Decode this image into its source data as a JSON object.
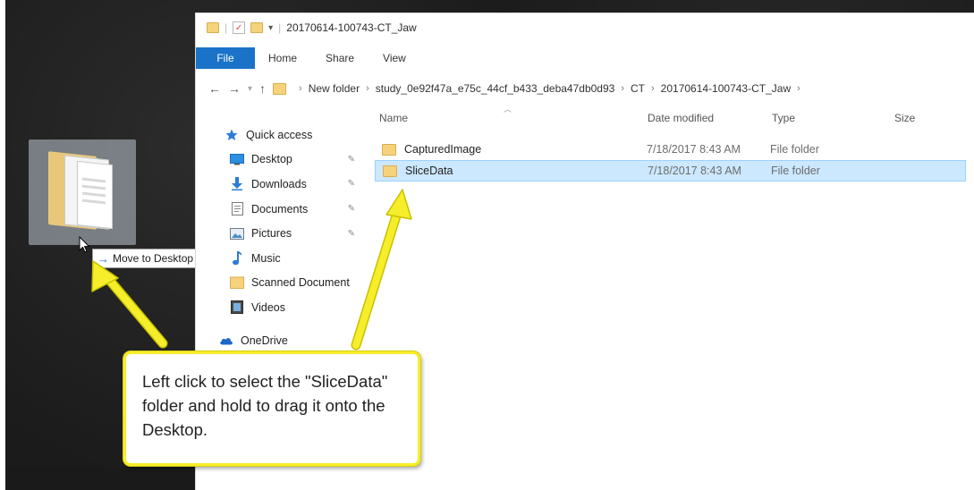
{
  "window": {
    "title": "20170614-100743-CT_Jaw"
  },
  "ribbon": {
    "tabs": [
      "File",
      "Home",
      "Share",
      "View"
    ]
  },
  "address": {
    "crumbs": [
      "New folder",
      "study_0e92f47a_e75c_44cf_b433_deba47db0d93",
      "CT",
      "20170614-100743-CT_Jaw"
    ]
  },
  "nav": {
    "items": [
      {
        "label": "Quick access",
        "icon": "star-icon",
        "pinned": false
      },
      {
        "label": "Desktop",
        "icon": "desktop-icon",
        "pinned": true
      },
      {
        "label": "Downloads",
        "icon": "download-icon",
        "pinned": true
      },
      {
        "label": "Documents",
        "icon": "documents-icon",
        "pinned": true
      },
      {
        "label": "Pictures",
        "icon": "pictures-icon",
        "pinned": true
      },
      {
        "label": "Music",
        "icon": "music-icon",
        "pinned": false
      },
      {
        "label": "Scanned Document",
        "icon": "folder-icon",
        "pinned": false
      },
      {
        "label": "Videos",
        "icon": "videos-icon",
        "pinned": false
      },
      {
        "label": "OneDrive",
        "icon": "cloud-icon",
        "pinned": false
      }
    ]
  },
  "list": {
    "columns": {
      "name": "Name",
      "date": "Date modified",
      "type": "Type",
      "size": "Size"
    },
    "rows": [
      {
        "name": "CapturedImage",
        "date": "7/18/2017 8:43 AM",
        "type": "File folder",
        "selected": false
      },
      {
        "name": "SliceData",
        "date": "7/18/2017 8:43 AM",
        "type": "File folder",
        "selected": true
      }
    ]
  },
  "drag": {
    "tooltip": "Move to Desktop"
  },
  "callout": {
    "text": "Left click to select the \"SliceData\" folder and hold to drag it onto the Desktop."
  },
  "colors": {
    "accent": "#1a73c8",
    "selection": "#cce8ff",
    "callout_border": "#f6ee2a",
    "folder": "#f5d27b"
  }
}
